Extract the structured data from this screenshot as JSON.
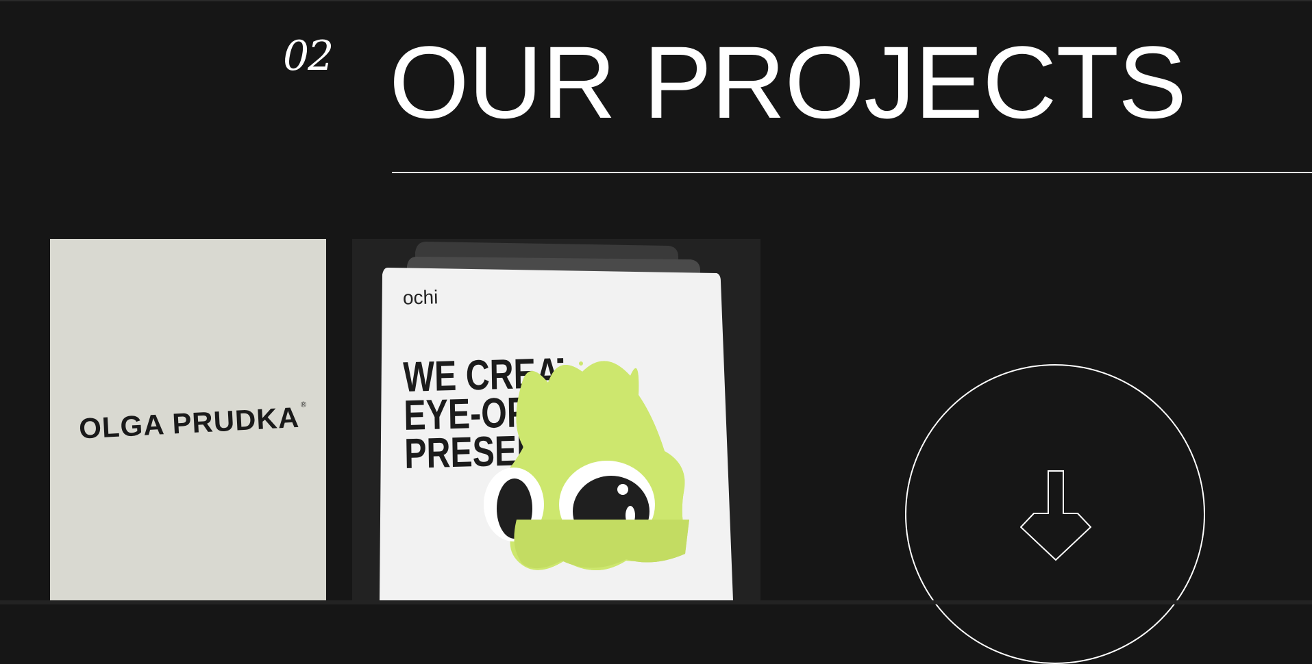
{
  "section": {
    "number": "02",
    "title": "OUR PROJECTS"
  },
  "projects": [
    {
      "logo_text": "OLGA PRUDKA",
      "logo_mark": "®"
    },
    {
      "brand": "ochi",
      "headline": [
        "WE CREATE",
        "EYE-OPEN",
        "PRESEN"
      ]
    }
  ],
  "scroll_button": {
    "icon": "arrow-down-icon"
  },
  "colors": {
    "background": "#161616",
    "text": "#ffffff",
    "olga_card": "#d9d9d1",
    "ochi_card": "#222222",
    "ochi_accent": "#cde76e"
  }
}
